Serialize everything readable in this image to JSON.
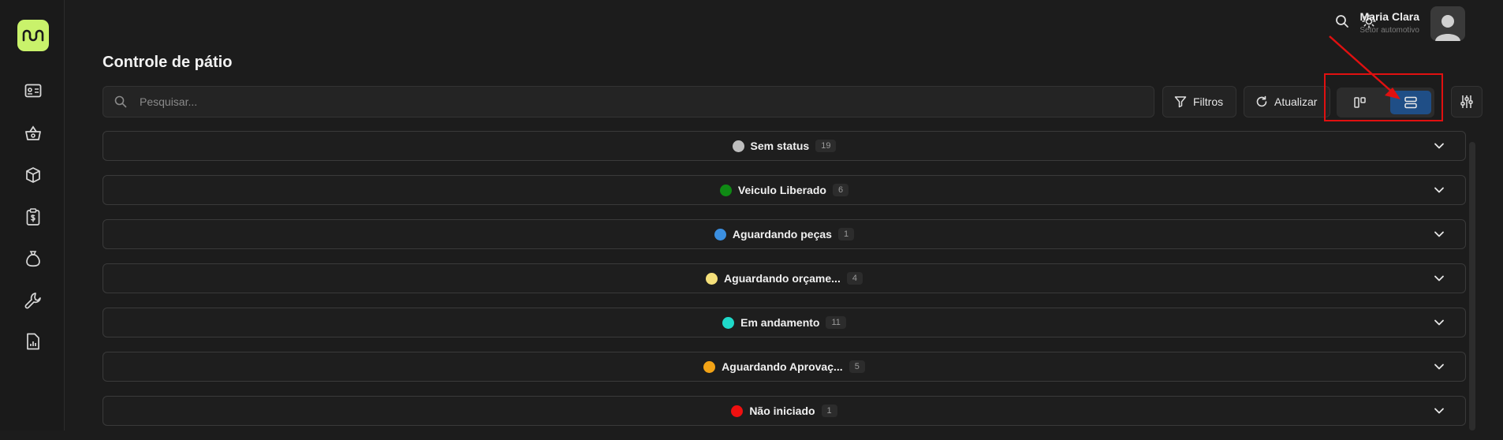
{
  "colors": {
    "accent_logo": "#c9f26b",
    "active_toggle": "#1f4e86",
    "highlight": "#e01010"
  },
  "sidebar": {
    "logo_icon": "brand-wave-icon",
    "items": [
      {
        "icon": "id-card-icon"
      },
      {
        "icon": "basket-icon"
      },
      {
        "icon": "box-icon"
      },
      {
        "icon": "clipboard-dollar-icon"
      },
      {
        "icon": "money-bag-icon"
      },
      {
        "icon": "wrench-icon"
      },
      {
        "icon": "report-chart-icon"
      }
    ]
  },
  "header": {
    "user_name": "Maria Clara",
    "user_role": "Setor automotivo"
  },
  "page": {
    "title": "Controle de pátio"
  },
  "toolbar": {
    "search_placeholder": "Pesquisar...",
    "filters_label": "Filtros",
    "refresh_label": "Atualizar",
    "view_modes": [
      {
        "name": "kanban-view",
        "active": false
      },
      {
        "name": "list-view",
        "active": true
      }
    ]
  },
  "groups": [
    {
      "label": "Sem status",
      "count": "19",
      "color": "#bdbdbd"
    },
    {
      "label": "Veiculo Liberado",
      "count": "6",
      "color": "#0f8a14"
    },
    {
      "label": "Aguardando peças",
      "count": "1",
      "color": "#3b8fe0"
    },
    {
      "label": "Aguardando orçame...",
      "count": "4",
      "color": "#f5e07a"
    },
    {
      "label": "Em andamento",
      "count": "11",
      "color": "#1fd9c9"
    },
    {
      "label": "Aguardando Aprovaç...",
      "count": "5",
      "color": "#f2a316"
    },
    {
      "label": "Não iniciado",
      "count": "1",
      "color": "#f01010"
    }
  ]
}
